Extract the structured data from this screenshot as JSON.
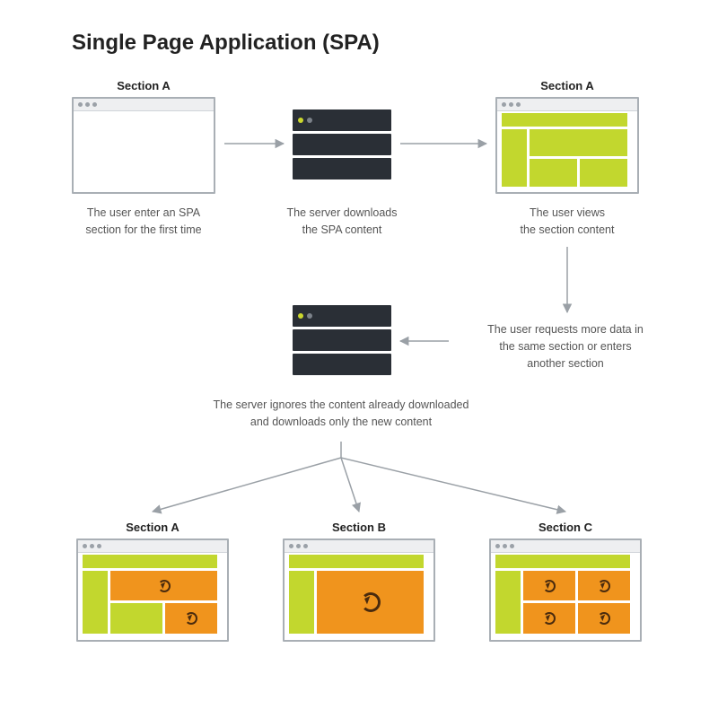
{
  "title": "Single Page Application (SPA)",
  "row1": {
    "sectionA1": "Section A",
    "sectionA2": "Section A",
    "cap1": "The user enter an SPA\nsection for the first time",
    "cap2": "The server downloads\nthe SPA content",
    "cap3": "The user views\nthe section content"
  },
  "row2": {
    "capRight": "The user requests more data in\nthe same section or enters\nanother section",
    "capServer": "The server ignores the content already downloaded\nand downloads only the new content"
  },
  "row3": {
    "secA": "Section A",
    "secB": "Section B",
    "secC": "Section C"
  },
  "colors": {
    "green": "#c2d72e",
    "orange": "#f0941d",
    "dark": "#2a2f36",
    "arrow": "#9aa0a6"
  }
}
